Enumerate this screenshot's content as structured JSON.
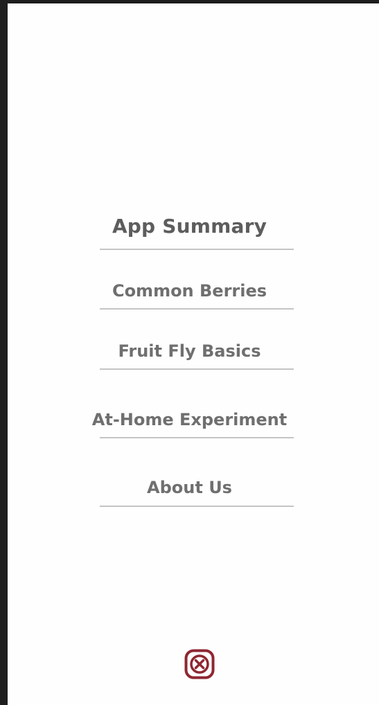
{
  "menu": {
    "items": [
      {
        "label": "App Summary"
      },
      {
        "label": "Common Berries"
      },
      {
        "label": "Fruit Fly Basics"
      },
      {
        "label": "At-Home Experiment"
      },
      {
        "label": "About Us"
      }
    ]
  },
  "close_button": {
    "icon": "close-icon",
    "color": "#8e2731"
  },
  "colors": {
    "background": "#fefefe",
    "side_bar": "#1e1e1e",
    "text": "#6f6f6f",
    "underline": "#c4c4c4"
  }
}
